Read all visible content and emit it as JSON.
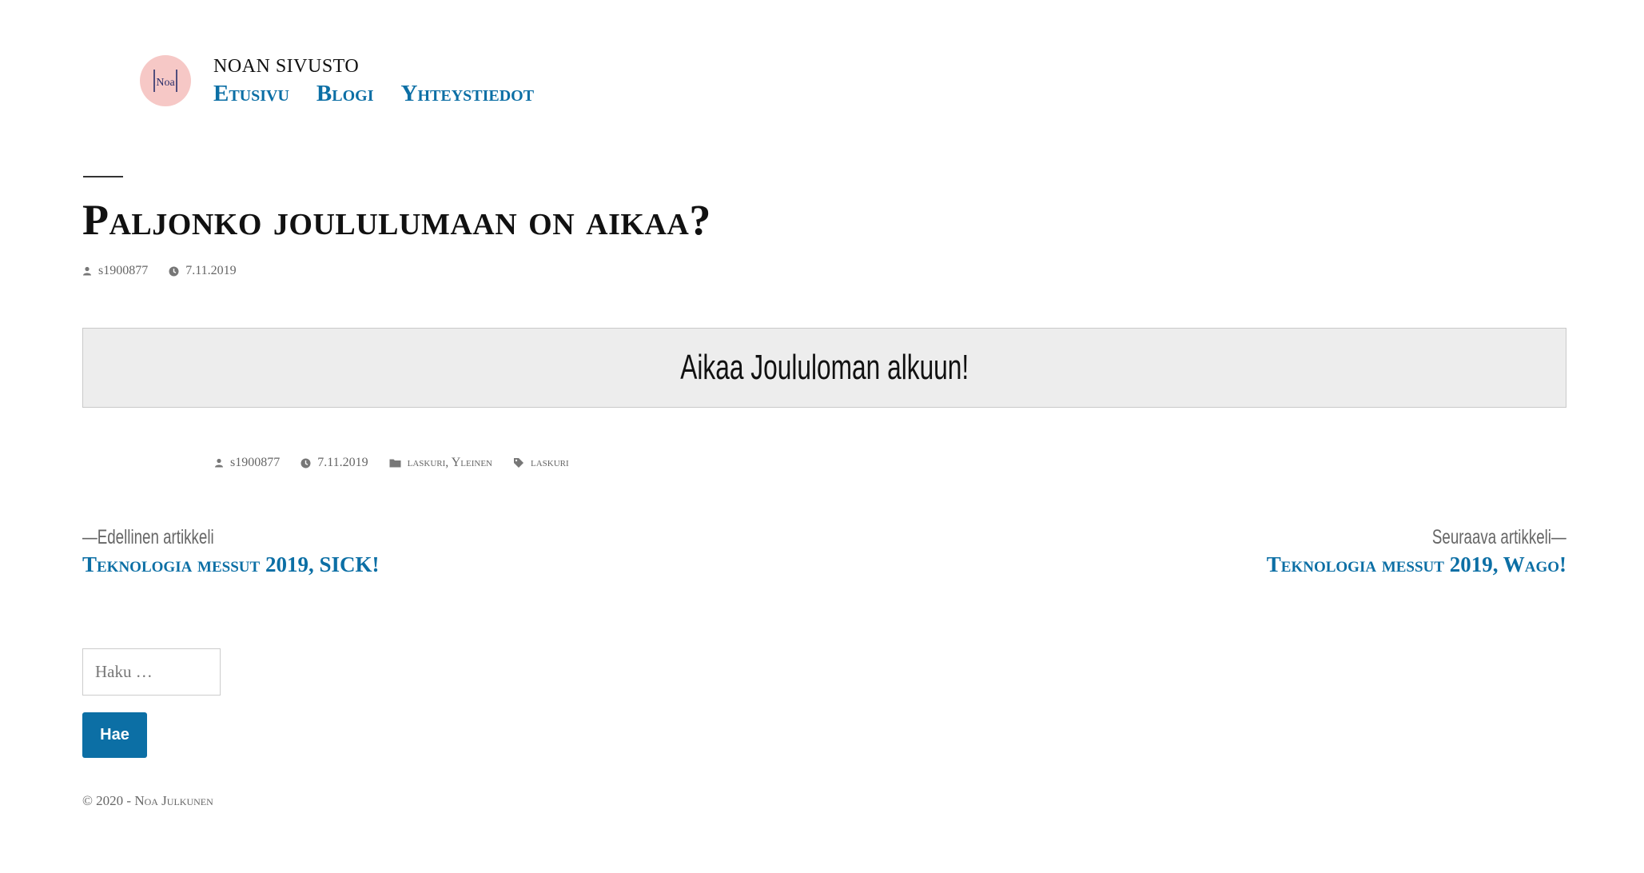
{
  "header": {
    "site_title": "NOAN SIVUSTO",
    "logo_text": "Noa",
    "nav": [
      {
        "label": "Etusivu"
      },
      {
        "label": "Blogi"
      },
      {
        "label": "Yhteystiedot"
      }
    ]
  },
  "post": {
    "title": "Paljonko joululumaan on aikaa?",
    "author": "s1900877",
    "date": "7.11.2019",
    "countdown_text": "Aikaa Joululoman alkuun!"
  },
  "entry_footer": {
    "author": "s1900877",
    "date": "7.11.2019",
    "categories": "laskuri, Yleinen",
    "tags": "laskuri"
  },
  "post_navigation": {
    "previous_label": "—Edellinen artikkeli",
    "previous_title": "Teknologia messut 2019, SICK!",
    "next_label": "Seuraava artikkeli—",
    "next_title": "Teknologia messut 2019, Wago!"
  },
  "search": {
    "placeholder": "Haku …",
    "value": "",
    "button_label": "Hae"
  },
  "footer": {
    "copyright": "© 2020 - Noa Julkunen"
  },
  "colors": {
    "accent": "#0c6fa5",
    "logo_bg": "#f6c8c6",
    "countdown_bg": "#ededed",
    "meta_text": "#666666"
  },
  "icons": [
    "person-icon",
    "clock-icon",
    "folder-icon",
    "tag-icon"
  ]
}
